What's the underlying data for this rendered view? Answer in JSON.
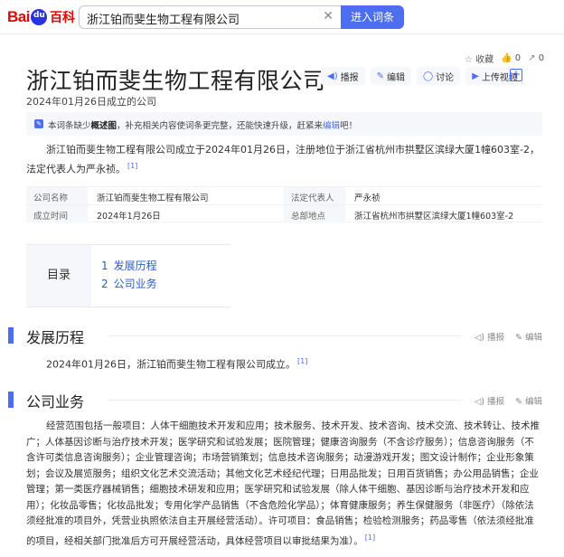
{
  "header": {
    "logo_bai": "Bai",
    "logo_du": "du",
    "logo_baike": "百科",
    "search_value": "浙江铂而斐生物工程有限公司",
    "search_button": "进入词条",
    "clear_icon": "✕"
  },
  "toolbar": {
    "collect": "收藏",
    "like_count": "0",
    "share_count": "0"
  },
  "title": "浙江铂而斐生物工程有限公司",
  "subtitle": "2024年01月26日成立的公司",
  "actions": {
    "report": "播报",
    "edit": "编辑",
    "discuss": "讨论",
    "upload_video": "上传视频",
    "add": "+"
  },
  "notice": {
    "pre": "本词条缺少",
    "bold": "概述图",
    "mid": "，补充相关内容使词条更完整，还能快速升级，赶紧来",
    "link": "编辑",
    "post": "吧！"
  },
  "summary": {
    "text": "浙江铂而斐生物工程有限公司成立于2024年01月26日，注册地位于浙江省杭州市拱墅区滨绿大厦1幢603室-2，法定代表人为严永祯。",
    "ref": "[1]"
  },
  "info": [
    {
      "k1": "公司名称",
      "v1": "浙江铂而斐生物工程有限公司",
      "k2": "法定代表人",
      "v2": "严永祯"
    },
    {
      "k1": "成立时间",
      "v1": "2024年1月26日",
      "k2": "总部地点",
      "v2": "浙江省杭州市拱墅区滨绿大厦1幢603室-2"
    }
  ],
  "toc": {
    "label": "目录",
    "items": [
      {
        "num": "1",
        "label": "发展历程"
      },
      {
        "num": "2",
        "label": "公司业务"
      }
    ]
  },
  "sections": [
    {
      "title": "发展历程",
      "report": "播报",
      "edit": "编辑"
    },
    {
      "title": "公司业务",
      "report": "播报",
      "edit": "编辑"
    }
  ],
  "history": {
    "text": "2024年01月26日，浙江铂而斐生物工程有限公司成立。",
    "ref": "[1]"
  },
  "business": {
    "text": "经营范围包括一般项目：人体干细胞技术开发和应用；技术服务、技术开发、技术咨询、技术交流、技术转让、技术推广；人体基因诊断与治疗技术开发；医学研究和试验发展；医院管理；健康咨询服务（不含诊疗服务）；信息咨询服务（不含许可类信息咨询服务）；企业管理咨询；市场营销策划；信息技术咨询服务；动漫游戏开发；图文设计制作；企业形象策划；会议及展览服务；组织文化艺术交流活动；其他文化艺术经纪代理；日用品批发；日用百货销售；办公用品销售；企业管理；第一类医疗器械销售；细胞技术研发和应用；医学研究和试验发展（除人体干细胞、基因诊断与治疗技术开发和应用）；化妆品零售；化妆品批发；专用化学产品销售（不含危险化学品）；体育健康服务；养生保健服务（非医疗）（除依法须经批准的项目外，凭营业执照依法自主开展经营活动）。许可项目：食品销售；检验检测服务；药品零售（依法须经批准的项目，经相关部门批准后方可开展经营活动，具体经营项目以审批结果为准）。",
    "ref": "[1]"
  }
}
